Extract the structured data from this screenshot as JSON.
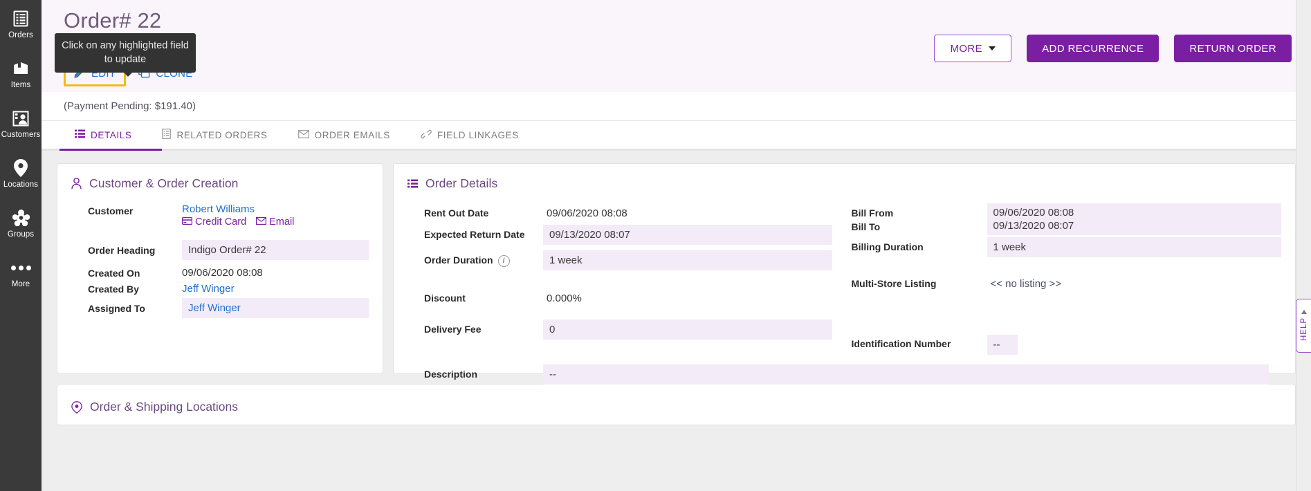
{
  "sidebar": {
    "items": [
      {
        "label": "Orders",
        "icon": "list-orders-icon"
      },
      {
        "label": "Items",
        "icon": "box-items-icon"
      },
      {
        "label": "Customers",
        "icon": "customers-icon"
      },
      {
        "label": "Locations",
        "icon": "map-pin-icon"
      },
      {
        "label": "Groups",
        "icon": "groups-gear-icon"
      },
      {
        "label": "More",
        "icon": "more-dots-icon"
      }
    ]
  },
  "header": {
    "title": "Order# 22",
    "tooltip": "Click on any highlighted field to update",
    "edit_label": "EDIT",
    "clone_label": "CLONE",
    "more_label": "MORE",
    "add_recurrence_label": "ADD RECURRENCE",
    "return_order_label": "RETURN ORDER",
    "payment_status": "(Payment Pending: $191.40)"
  },
  "tabs": [
    {
      "label": "DETAILS",
      "icon": "list-icon",
      "active": true
    },
    {
      "label": "RELATED ORDERS",
      "icon": "document-icon",
      "active": false
    },
    {
      "label": "ORDER EMAILS",
      "icon": "envelope-icon",
      "active": false
    },
    {
      "label": "FIELD LINKAGES",
      "icon": "link-icon",
      "active": false
    }
  ],
  "customer_card": {
    "title": "Customer & Order Creation",
    "icon": "person-icon",
    "customer_label": "Customer",
    "customer_name": "Robert Williams",
    "credit_card_label": "Credit Card",
    "email_label": "Email",
    "order_heading_label": "Order Heading",
    "order_heading_value": "Indigo Order# 22",
    "created_on_label": "Created On",
    "created_on_value": "09/06/2020 08:08",
    "created_by_label": "Created By",
    "created_by_value": "Jeff Winger",
    "assigned_to_label": "Assigned To",
    "assigned_to_value": "Jeff Winger"
  },
  "order_details": {
    "title": "Order Details",
    "icon": "list-icon",
    "rent_out_date_label": "Rent Out Date",
    "rent_out_date_value": "09/06/2020 08:08",
    "expected_return_date_label": "Expected Return Date",
    "expected_return_date_value": "09/13/2020 08:07",
    "order_duration_label": "Order Duration",
    "order_duration_value": "1 week",
    "discount_label": "Discount",
    "discount_value": "0.000%",
    "delivery_fee_label": "Delivery Fee",
    "delivery_fee_value": "0",
    "description_label": "Description",
    "description_value": "--",
    "bill_from_label": "Bill From",
    "bill_from_value": "09/06/2020 08:08",
    "bill_to_label": "Bill To",
    "bill_to_value": "09/13/2020 08:07",
    "billing_duration_label": "Billing Duration",
    "billing_duration_value": "1 week",
    "multi_store_listing_label": "Multi-Store Listing",
    "multi_store_listing_value": "<< no listing >>",
    "identification_number_label": "Identification Number",
    "identification_number_value": "--"
  },
  "locations_card": {
    "title": "Order & Shipping Locations",
    "icon": "target-pin-icon"
  },
  "help": {
    "label": "HELP"
  },
  "colors": {
    "brand_purple": "#7b1fa2",
    "header_bg": "#faf5fb",
    "highlight_field": "#f3ebf8",
    "edit_outline": "#f5b916",
    "link_blue": "#1f6fd0",
    "sidebar_bg": "#3a3a3a"
  }
}
